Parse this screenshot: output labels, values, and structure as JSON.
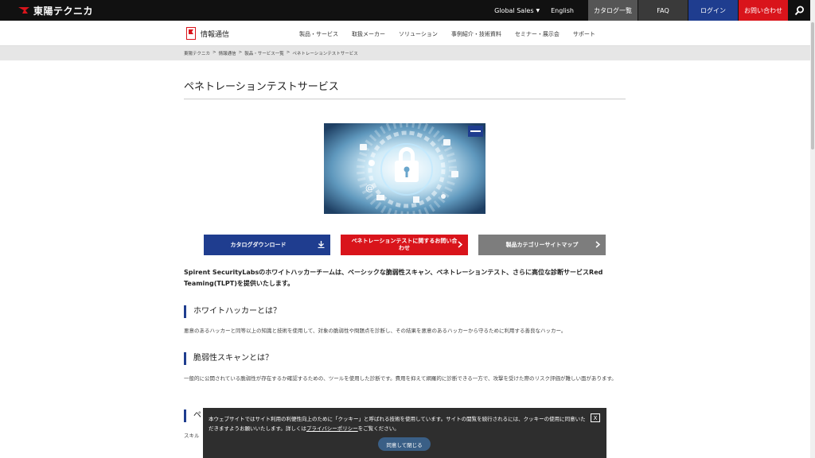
{
  "header": {
    "logo_text": "東陽テクニカ",
    "global_sales": "Global Sales",
    "global_caret": "▼",
    "english": "English",
    "catalog": "カタログ一覧",
    "faq": "FAQ",
    "login": "ログイン",
    "contact": "お問い合わせ",
    "search_glyph": "⚲"
  },
  "nav": {
    "brand": "情報通信",
    "links": [
      "製品・サービス",
      "取扱メーカー",
      "ソリューション",
      "事例紹介・技術資料",
      "セミナー・展示会",
      "サポート"
    ]
  },
  "breadcrumb": [
    "東陽テクニカ",
    ">",
    "情報通信",
    ">",
    "製品・サービス一覧",
    ">",
    "ペネトレーションテストサービス"
  ],
  "page": {
    "title": "ペネトレーションテストサービス",
    "cta": [
      {
        "label": "カタログダウンロード",
        "icon": "download-icon"
      },
      {
        "label": "ペネトレーションテストに関するお問い合わせ",
        "icon": "chevron-right-icon"
      },
      {
        "label": "製品カテゴリーサイトマップ",
        "icon": "chevron-right-icon"
      }
    ],
    "lead": "Spirent SecurityLabsのホワイトハッカーチームは、ベーシックな脆弱性スキャン、ペネトレーションテスト、さらに高位な診断サービスRed Teaming(TLPT)を提供いたします。",
    "sections": [
      {
        "heading": "ホワイトハッカーとは？",
        "body": "悪意のあるハッカーと同等以上の知識と技術を使用して、対象の脆弱性や問題点を診断し、その結果を悪意のあるハッカーから守るために利用する善良なハッカー。"
      },
      {
        "heading": "脆弱性スキャンとは？",
        "body": "一般的に公開されている脆弱性が存在するか確認するための、ツールを使用した診断です。費用を抑えて網羅的に診断できる一方で、攻撃を受けた際のリスク評価が難しい面があります。"
      },
      {
        "heading": "ペ",
        "body": "スキル"
      }
    ]
  },
  "cookie": {
    "message_before": "本ウェブサイトではサイト利用の利便性向上のために「クッキー」と呼ばれる技術を使用しています。サイトの閲覧を続行されるには、クッキーの使用に同意いただきますようお願いいたします。詳しくは",
    "link": "プライバシーポリシー",
    "message_after": "をご覧ください。",
    "close": "X",
    "agree": "同意して閉じる"
  },
  "colors": {
    "navy": "#1f3d8f",
    "red": "#d9141b",
    "gray": "#7d7d7d"
  }
}
